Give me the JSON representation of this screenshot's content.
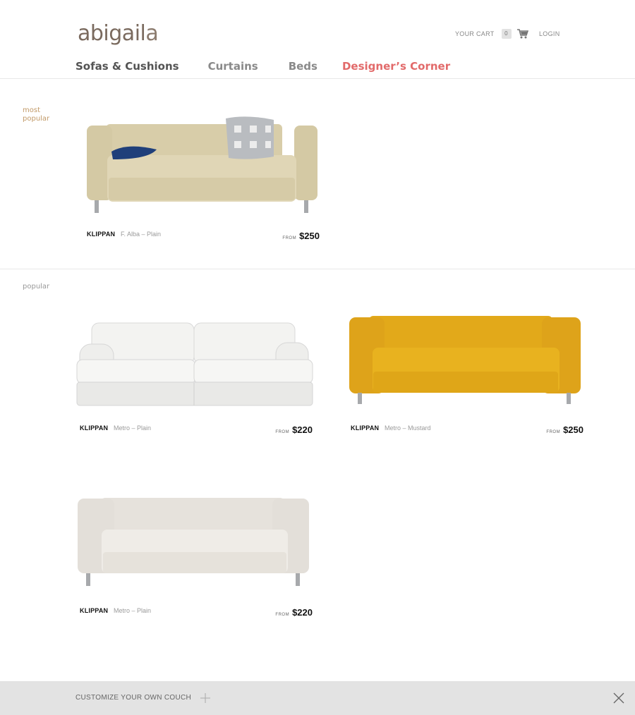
{
  "brand": {
    "logo_main": "abigail",
    "logo_last": "a"
  },
  "header": {
    "cart_label": "YOUR CART",
    "cart_count": "0",
    "login_label": "LOGIN"
  },
  "nav": {
    "items": [
      {
        "label": "Sofas & Cushions"
      },
      {
        "label": "Curtains"
      },
      {
        "label": "Beds"
      },
      {
        "label": "Designer’s Corner"
      }
    ],
    "accent_color": "#e26a6a"
  },
  "sections": {
    "most_popular": {
      "label": "most popular",
      "color": "#c29a68"
    },
    "popular": {
      "label": "popular",
      "color": "#999999"
    }
  },
  "products": [
    {
      "name": "KLIPPAN",
      "variant": "F. Alba – Plain",
      "from_label": "FROM",
      "price": "$250",
      "color": "#d9cfae"
    },
    {
      "name": "KLIPPAN",
      "variant": "Metro – Plain",
      "from_label": "FROM",
      "price": "$220",
      "color": "#f0f0ee"
    },
    {
      "name": "KLIPPAN",
      "variant": "Metro – Mustard",
      "from_label": "FROM",
      "price": "$250",
      "color": "#e2aa1c"
    },
    {
      "name": "KLIPPAN",
      "variant": "Metro – Plain",
      "from_label": "FROM",
      "price": "$220",
      "color": "#ebe8e3"
    }
  ],
  "footer": {
    "customize_label": "CUSTOMIZE YOUR OWN COUCH"
  },
  "icons": [
    "cart-icon",
    "plus-icon",
    "close-icon"
  ]
}
